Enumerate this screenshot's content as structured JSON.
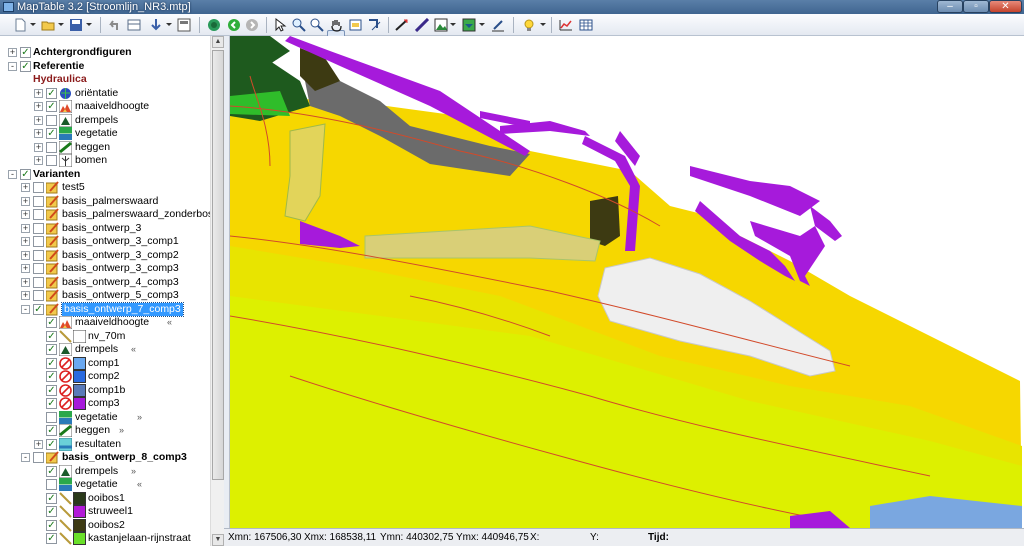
{
  "window": {
    "title": "MapTable 3.2 [Stroomlijn_NR3.mtp]"
  },
  "toolbar": {
    "icons": [
      "new-icon",
      "open-icon",
      "save-icon",
      "undo-icon",
      "edit-table-icon",
      "add-point-icon",
      "layout-icon",
      "globe-icon",
      "back-icon",
      "forward-icon",
      "select-arrow-icon",
      "zoom-in-icon",
      "zoom-out-icon",
      "pan-hand-icon",
      "zoom-full-icon",
      "select-region-icon",
      "draw-line-icon",
      "measure-icon",
      "image-icon",
      "fill-style-icon",
      "edit-style-icon",
      "lightbulb-icon",
      "table-view-icon",
      "grid-icon"
    ]
  },
  "tree": {
    "rows": [
      {
        "label": "Achtergrondfiguren",
        "level": 0,
        "exp": "+",
        "checked": true,
        "icon": "",
        "bold": true
      },
      {
        "label": "Referentie",
        "level": 0,
        "exp": "-",
        "checked": true,
        "icon": "",
        "bold": true
      },
      {
        "label": "Hydraulica",
        "level": 1,
        "exp": "",
        "checked": null,
        "icon": "",
        "group": true
      },
      {
        "label": "oriëntatie",
        "level": 2,
        "exp": "+",
        "checked": true,
        "icon": "globe"
      },
      {
        "label": "maaiveldhoogte",
        "level": 2,
        "exp": "+",
        "checked": true,
        "icon": "relief"
      },
      {
        "label": "drempels",
        "level": 2,
        "exp": "+",
        "checked": false,
        "icon": "triangle"
      },
      {
        "label": "vegetatie",
        "level": 2,
        "exp": "+",
        "checked": true,
        "icon": "vegetation"
      },
      {
        "label": "heggen",
        "level": 2,
        "exp": "+",
        "checked": false,
        "icon": "hedge"
      },
      {
        "label": "bomen",
        "level": 2,
        "exp": "+",
        "checked": false,
        "icon": "tree"
      },
      {
        "label": "Varianten",
        "level": 0,
        "exp": "-",
        "checked": true,
        "icon": "",
        "bold": true
      },
      {
        "label": "test5",
        "level": 1,
        "exp": "+",
        "checked": false,
        "icon": "edit"
      },
      {
        "label": "basis_palmerswaard",
        "level": 1,
        "exp": "+",
        "checked": false,
        "icon": "edit"
      },
      {
        "label": "basis_palmerswaard_zonderbos",
        "level": 1,
        "exp": "+",
        "checked": false,
        "icon": "edit"
      },
      {
        "label": "basis_ontwerp_3",
        "level": 1,
        "exp": "+",
        "checked": false,
        "icon": "edit"
      },
      {
        "label": "basis_ontwerp_3_comp1",
        "level": 1,
        "exp": "+",
        "checked": false,
        "icon": "edit"
      },
      {
        "label": "basis_ontwerp_3_comp2",
        "level": 1,
        "exp": "+",
        "checked": false,
        "icon": "edit"
      },
      {
        "label": "basis_ontwerp_3_comp3",
        "level": 1,
        "exp": "+",
        "checked": false,
        "icon": "edit"
      },
      {
        "label": "basis_ontwerp_4_comp3",
        "level": 1,
        "exp": "+",
        "checked": false,
        "icon": "edit"
      },
      {
        "label": "basis_ontwerp_5_comp3",
        "level": 1,
        "exp": "+",
        "checked": false,
        "icon": "edit"
      },
      {
        "label": "basis_ontwerp_7_comp3",
        "level": 1,
        "exp": "-",
        "checked": true,
        "icon": "edit",
        "selected": true
      },
      {
        "label": "maaiveldhoogte",
        "level": 2,
        "exp": "",
        "checked": true,
        "icon": "relief",
        "suffix": "«"
      },
      {
        "label": "nv_70m",
        "level": 2,
        "exp": "",
        "checked": true,
        "icon": "line-white"
      },
      {
        "label": "drempels",
        "level": 2,
        "exp": "",
        "checked": true,
        "icon": "triangle",
        "suffix": "«"
      },
      {
        "label": "comp1",
        "level": 2,
        "exp": "",
        "checked": true,
        "icon": "swatch-lightblue"
      },
      {
        "label": "comp2",
        "level": 2,
        "exp": "",
        "checked": true,
        "icon": "swatch-blue"
      },
      {
        "label": "comp1b",
        "level": 2,
        "exp": "",
        "checked": true,
        "icon": "swatch-steel"
      },
      {
        "label": "comp3",
        "level": 2,
        "exp": "",
        "checked": true,
        "icon": "swatch-purple"
      },
      {
        "label": "vegetatie",
        "level": 2,
        "exp": "",
        "checked": false,
        "icon": "vegetation",
        "suffix": "»"
      },
      {
        "label": "heggen",
        "level": 2,
        "exp": "",
        "checked": true,
        "icon": "hedge",
        "suffix": "»"
      },
      {
        "label": "resultaten",
        "level": 2,
        "exp": "+",
        "checked": true,
        "icon": "results"
      },
      {
        "label": "basis_ontwerp_8_comp3",
        "level": 1,
        "exp": "-",
        "checked": false,
        "icon": "edit",
        "bold": true
      },
      {
        "label": "drempels",
        "level": 2,
        "exp": "",
        "checked": true,
        "icon": "triangle",
        "suffix": "»"
      },
      {
        "label": "vegetatie",
        "level": 2,
        "exp": "",
        "checked": false,
        "icon": "vegetation",
        "suffix": "«"
      },
      {
        "label": "ooibos1",
        "level": 2,
        "exp": "",
        "checked": true,
        "icon": "swatch-darkgreen"
      },
      {
        "label": "struweel1",
        "level": 2,
        "exp": "",
        "checked": true,
        "icon": "swatch-magenta"
      },
      {
        "label": "ooibos2",
        "level": 2,
        "exp": "",
        "checked": true,
        "icon": "swatch-olive"
      },
      {
        "label": "kastanjelaan-rijnstraat",
        "level": 2,
        "exp": "",
        "checked": true,
        "icon": "swatch-lime"
      }
    ]
  },
  "status": {
    "xmn": "Xmn: 167506,30",
    "xmx": "Xmx: 168538,11",
    "ymn": "Ymn: 440302,75",
    "ymx": "Ymx: 440946,75",
    "x": "X:",
    "y": "Y:",
    "tijd": "Tijd:"
  },
  "colors": {
    "yellow": "#f6d700",
    "lime": "#ddf000",
    "purple": "#a61adb",
    "gray": "#6b6b6b",
    "darkgreen": "#1e5a1e",
    "green": "#2fbd2a",
    "olive": "#3d3a12",
    "lightgray": "#efefef",
    "selection": "#3399ff"
  }
}
